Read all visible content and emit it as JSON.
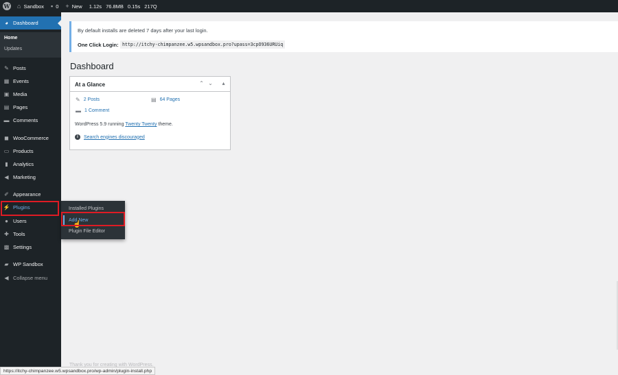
{
  "adminbar": {
    "site_name": "Sandbox",
    "comments_count": "0",
    "new_label": "New",
    "stats": [
      "1.12s",
      "76.8MB",
      "0.15s",
      "217Q"
    ]
  },
  "sidebar": {
    "dashboard": "Dashboard",
    "dashboard_sub": [
      "Home",
      "Updates"
    ],
    "items": [
      "Posts",
      "Events",
      "Media",
      "Pages",
      "Comments",
      "WooCommerce",
      "Products",
      "Analytics",
      "Marketing",
      "Appearance",
      "Plugins",
      "Users",
      "Tools",
      "Settings",
      "WP Sandbox"
    ],
    "collapse": "Collapse menu"
  },
  "flyout": {
    "items": [
      "Installed Plugins",
      "Add New",
      "Plugin File Editor"
    ]
  },
  "notice": {
    "text": "By default installs are deleted 7 days after your last login.",
    "login_label": "One Click Login:",
    "login_url": "http://itchy-chimpanzee.w5.wpsandbox.pro?upass=3cpO936URUiq"
  },
  "page_title": "Dashboard",
  "at_a_glance": {
    "title": "At a Glance",
    "posts": "2 Posts",
    "pages": "64 Pages",
    "comments": "1 Comment",
    "version_prefix": "WordPress 5.9 running",
    "theme": "Twenty Twenty",
    "version_suffix": "theme.",
    "search_warning": "Search engines discouraged"
  },
  "footer": {
    "thanks": "Thank you for creating with WordPress."
  },
  "status_url": "https://itchy-chimpanzee.w5.wpsandbox.pro/wp-admin/plugin-install.php",
  "colors": {
    "admin_dark": "#1d2327",
    "accent_blue": "#2271b1",
    "link_blue": "#72aee6",
    "highlight_red": "#e01b24"
  }
}
